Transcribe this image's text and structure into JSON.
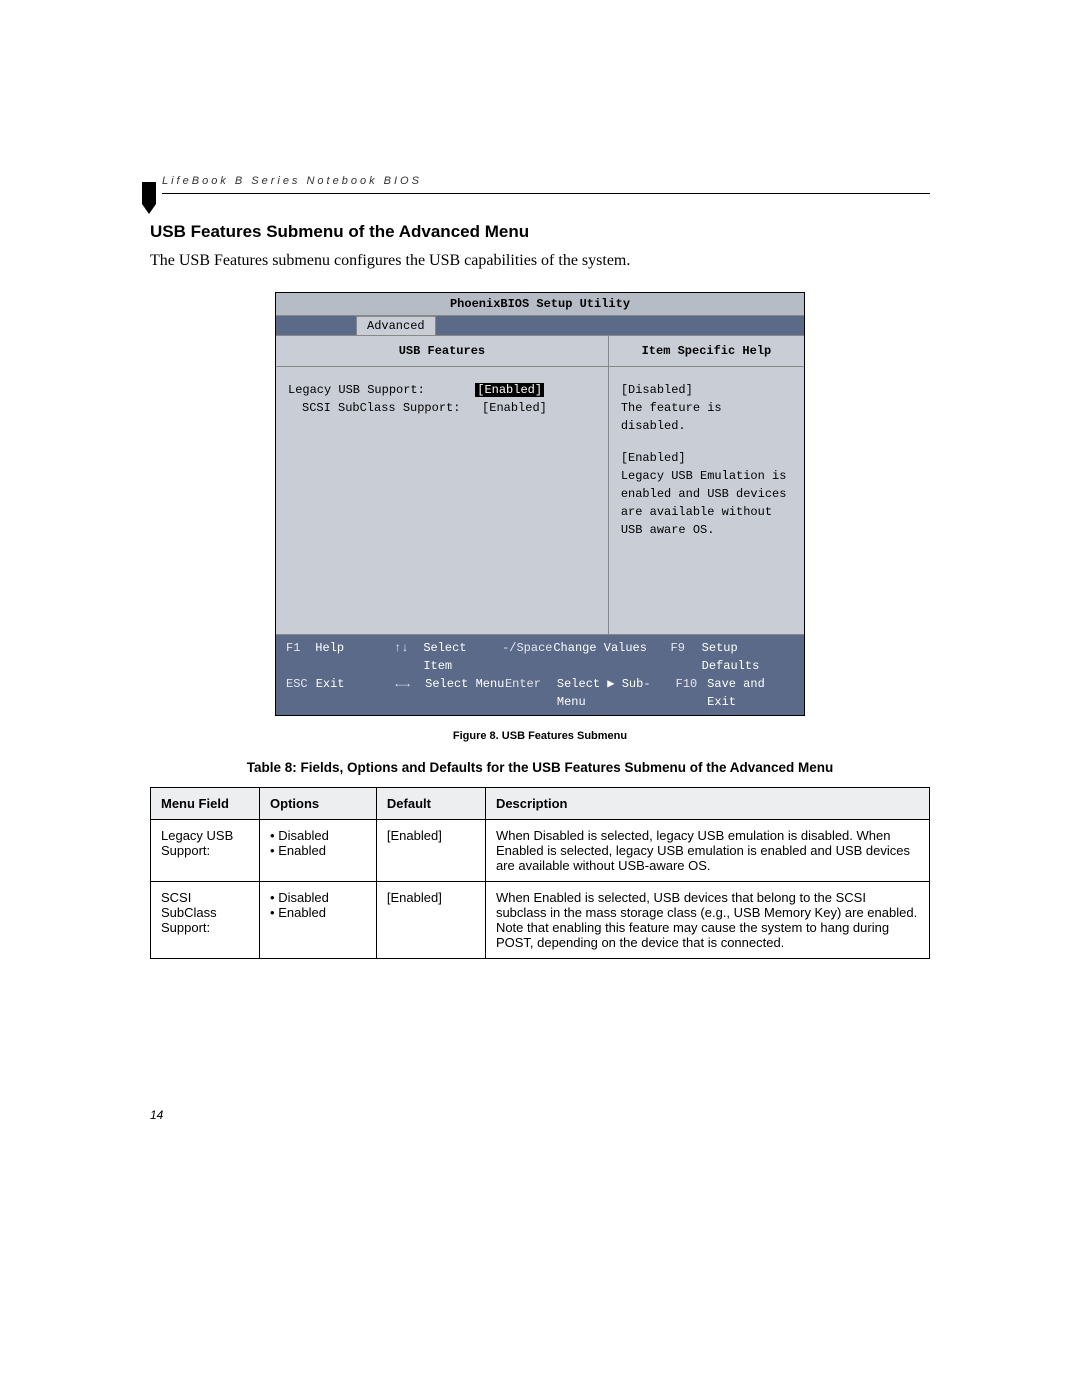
{
  "running_head": "LifeBook B Series Notebook BIOS",
  "section": {
    "title": "USB Features Submenu of the Advanced Menu",
    "intro": "The USB Features submenu configures the USB capabilities of the system."
  },
  "bios": {
    "utility_title": "PhoenixBIOS Setup Utility",
    "tab": "Advanced",
    "left_title": "USB Features",
    "right_title": "Item Specific Help",
    "settings": [
      {
        "label": "Legacy USB Support:",
        "value": "[Enabled]",
        "selected": true,
        "indent": false
      },
      {
        "label": "SCSI SubClass Support:",
        "value": "[Enabled]",
        "selected": false,
        "indent": true
      }
    ],
    "help": {
      "block1_head": "[Disabled]",
      "block1_body": "The feature is disabled.",
      "block2_head": "[Enabled]",
      "block2_body": "Legacy USB Emulation is enabled and USB devices are available without USB aware OS."
    },
    "footer": {
      "f1": "F1",
      "help": "Help",
      "arrows_v": "↑↓",
      "select_item": "Select Item",
      "minus_space": "-/Space",
      "change_values": "Change Values",
      "f9": "F9",
      "setup_defaults": "Setup Defaults",
      "esc": "ESC",
      "exit": "Exit",
      "arrows_h": "←→",
      "select_menu": "Select Menu",
      "enter": "Enter",
      "select_sub": "Select ▶ Sub-Menu",
      "f10": "F10",
      "save_exit": "Save and Exit"
    }
  },
  "figure_caption": "Figure 8.  USB Features Submenu",
  "table_caption": "Table 8: Fields, Options and Defaults for the USB Features Submenu of the Advanced Menu",
  "table": {
    "headers": {
      "menu_field": "Menu Field",
      "options": "Options",
      "default": "Default",
      "description": "Description"
    },
    "rows": [
      {
        "menu_field": "Legacy USB Support:",
        "options": [
          "Disabled",
          "Enabled"
        ],
        "default": "[Enabled]",
        "description": "When Disabled is selected, legacy USB emulation is disabled. When Enabled is selected, legacy USB emulation is enabled and USB devices are available without USB-aware OS."
      },
      {
        "menu_field": "SCSI SubClass Support:",
        "options": [
          "Disabled",
          "Enabled"
        ],
        "default": "[Enabled]",
        "description": "When Enabled is selected, USB devices that belong to the SCSI subclass in the mass storage class (e.g., USB Memory Key) are enabled. Note that enabling this feature may cause the system to hang during POST, depending on the device that is connected."
      }
    ]
  },
  "page_number": "14"
}
